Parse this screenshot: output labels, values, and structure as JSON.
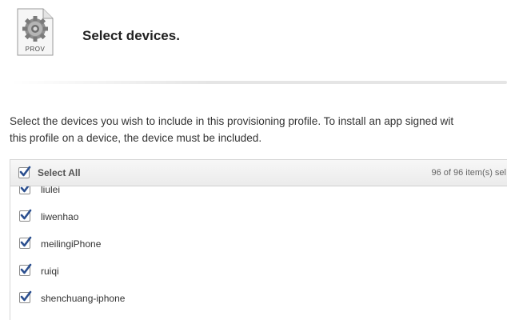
{
  "header": {
    "icon_label": "PROV",
    "title": "Select devices."
  },
  "description": {
    "line1": "Select the devices you wish to include in this provisioning profile. To install an app signed wit",
    "line2": "this profile on a device, the device must be included."
  },
  "table": {
    "select_all_label": "Select All",
    "select_all_checked": true,
    "count_text": "96 of 96 item(s) sel",
    "rows": [
      {
        "label": "liulei",
        "checked": true
      },
      {
        "label": "liwenhao",
        "checked": true
      },
      {
        "label": "meilingiPhone",
        "checked": true
      },
      {
        "label": "ruiqi",
        "checked": true
      },
      {
        "label": "shenchuang-iphone",
        "checked": true
      }
    ]
  },
  "colors": {
    "checkmark": "#2b4f8f",
    "header_bg": "#efefef",
    "text": "#333333"
  },
  "icons": [
    "document-gear-icon",
    "checkbox-checked-icon"
  ]
}
